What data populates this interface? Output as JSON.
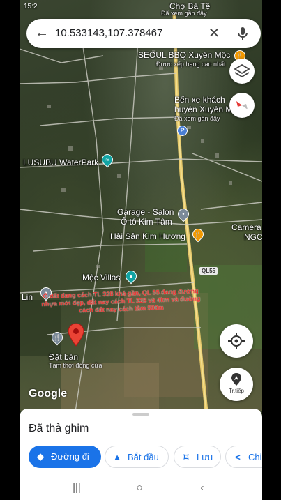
{
  "status": {
    "time": "15:2"
  },
  "search": {
    "query": "10.533143,107.378467"
  },
  "map": {
    "labels": {
      "cho_ba_te": "Chợ Bà Tệ",
      "cho_ba_te_sub": "Đã xem gần đây",
      "seoul_bbq": "SEOUL BBQ Xuyên Mộc",
      "seoul_bbq_sub": "Được xếp hạng cao nhất",
      "ben_xe_line1": "Bến xe khách",
      "ben_xe_line2": "huyện Xuyên M",
      "ben_xe_sub": "Đã xem gần đây",
      "lusubu": "LUSUBU WaterPark",
      "garage_line1": "Garage - Salon",
      "garage_line2": "Ô tô Kim Tâm",
      "hai_san": "Hải Sản Kim Hương",
      "camera_line1": "Camera",
      "camera_line2": "NGC",
      "moc_villas": "Mộc Villas",
      "lin": "Lin",
      "dat_ban": "Đặt bàn",
      "dat_ban_sub": "Tạm thời đóng cửa",
      "road": "QL55",
      "annotation": "Ô đất đang cách TL 328 khá gần, QL 55 đang đường nhựa mới đẹp, đất nay cách TL 328 và 4km và đường cách đất nay cách tâm 500m"
    },
    "google": "Google",
    "nav_button_label": "Tr.tiếp"
  },
  "sheet": {
    "title": "Đã thả ghim",
    "chips": {
      "directions": "Đường đi",
      "start": "Bắt đầu",
      "save": "Lưu",
      "share": "Chi"
    }
  },
  "colors": {
    "accent": "#1a73e8",
    "pin": "#ea4335",
    "annotation": "#e53935"
  }
}
